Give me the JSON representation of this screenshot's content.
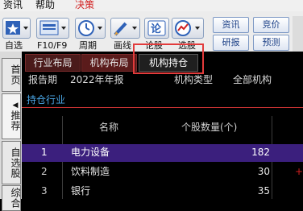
{
  "menu": [
    "资讯",
    "帮助",
    "决策"
  ],
  "toolbar": {
    "buttons": [
      {
        "label": "自选",
        "icon": "star-list-icon"
      },
      {
        "label": "F10/F9",
        "icon": "f10-card-icon"
      },
      {
        "label": "周期",
        "icon": "clock-cycle-icon"
      },
      {
        "label": "画线",
        "icon": "pencil-draw-icon"
      },
      {
        "label": "论股",
        "icon": "comment-stock-icon"
      },
      {
        "label": "选股",
        "icon": "stock-pick-icon"
      }
    ],
    "right_buttons": [
      "资讯",
      "竞价",
      "研报",
      "预测"
    ]
  },
  "sidetabs": [
    "首页",
    "推荐",
    "自选股",
    "综合"
  ],
  "tabs": [
    "行业布局",
    "机构布局",
    "机构持仓"
  ],
  "filters": {
    "report_label": "报告期",
    "report_value": "2022年年报",
    "inst_label": "机构类型",
    "inst_value": "全部机构"
  },
  "section_title": "持仓行业",
  "table": {
    "headers": [
      "名称",
      "个股数量(个)"
    ],
    "rows": [
      {
        "idx": "1",
        "name": "电力设备",
        "count": "182"
      },
      {
        "idx": "2",
        "name": "饮料制造",
        "count": "30"
      },
      {
        "idx": "3",
        "name": "银行",
        "count": "35"
      }
    ]
  },
  "colors": {
    "accent": "#1e6fd0",
    "menu_red": "#d21f1f",
    "selected_row": "#3b1f7d",
    "highlight_box": "#e23b3b",
    "section_text": "#4aa6e6"
  }
}
